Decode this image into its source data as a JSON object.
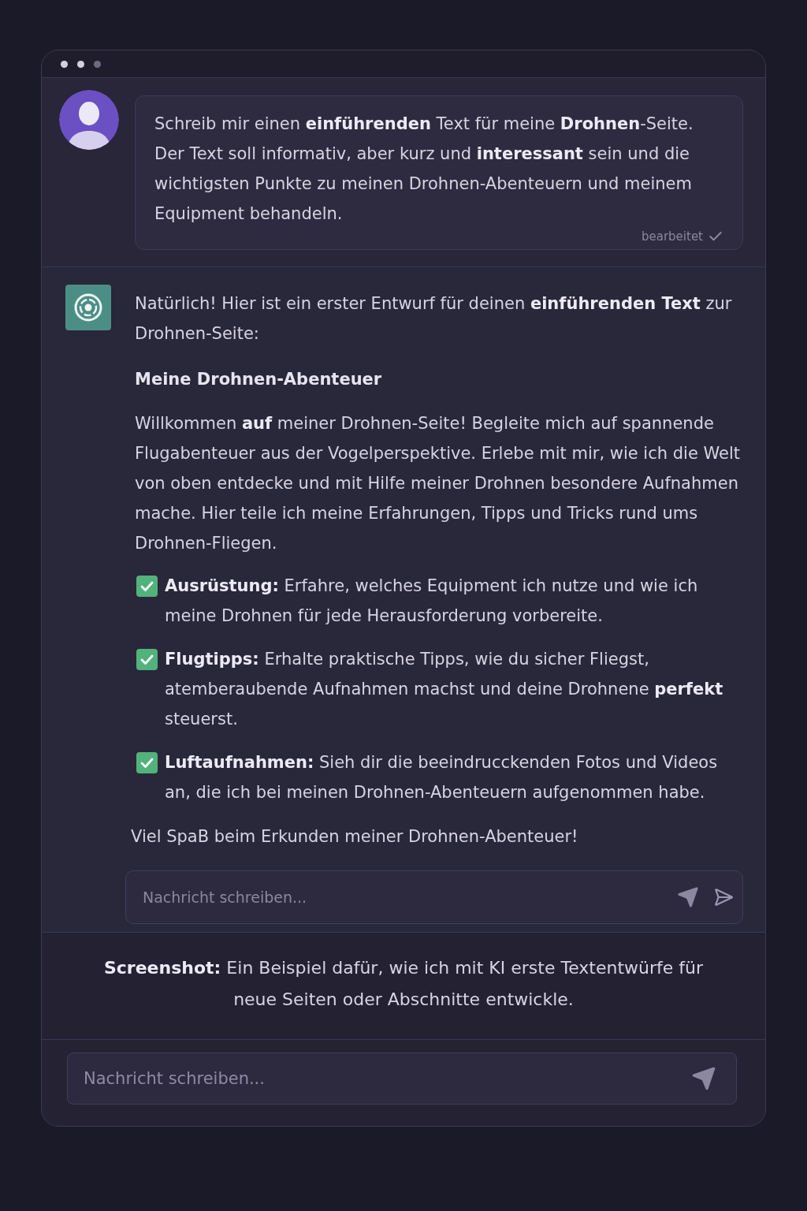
{
  "user_message": {
    "text": "Schreib mir einen **einführenden** Text für meine **Drohnen**-Seite. Der Text soll informativ, aber kurz und **interessant** sein und die wichtigsten Punkte zu meinen Drohnen-Abenteuern und meinem Equipment behandeln.",
    "status": "bearbeitet"
  },
  "assistant_message": {
    "intro": "Natürlich! Hier ist ein erster Entwurf für deinen **einführenden Text** zur Drohnen-Seite:",
    "heading": "Meine Drohnen-Abenteuer",
    "paragraph": "Willkommen **auf** meiner Drohnen-Seite! Begleite mich auf spannende Flugabenteuer aus der Vogelperspektive. Erlebe mit mir, wie ich die Welt von oben entdecke und mit Hilfe meiner Drohnen besondere Aufnahmen mache. Hier teile ich meine Erfahrungen, Tipps und Tricks rund ums Drohnen-Fliegen.",
    "checklist": [
      {
        "label": "Ausrüstung:",
        "text": "Erfahre, welches Equipment ich nutze und wie ich meine Drohnen für jede Herausforderung vorbereite.",
        "checked": true
      },
      {
        "label": "Flugtipps:",
        "text": "Erhalte praktische Tipps, wie du sicher Fliegst, atemberaubende Aufnahmen machst und deine Drohnene **perfekt** steuerst.",
        "checked": true
      },
      {
        "label": "Luftaufnahmen:",
        "text": "Sieh dir die beeindrucckenden Fotos und Videos an, die ich bei meinen Drohnen-Abenteuern aufgenommen habe.",
        "checked": true
      }
    ],
    "closing": "Viel SpaB beim Erkunden meiner Drohnen-Abenteuer!"
  },
  "reply_field": {
    "placeholder": "Nachricht schreiben..."
  },
  "caption": "**Screenshot:** Ein Beispiel dafür, wie ich mit KI erste Textentwürfe für neue Seiten oder Abschnitte entwickle.",
  "composer": {
    "placeholder": "Nachricht schreiben..."
  }
}
